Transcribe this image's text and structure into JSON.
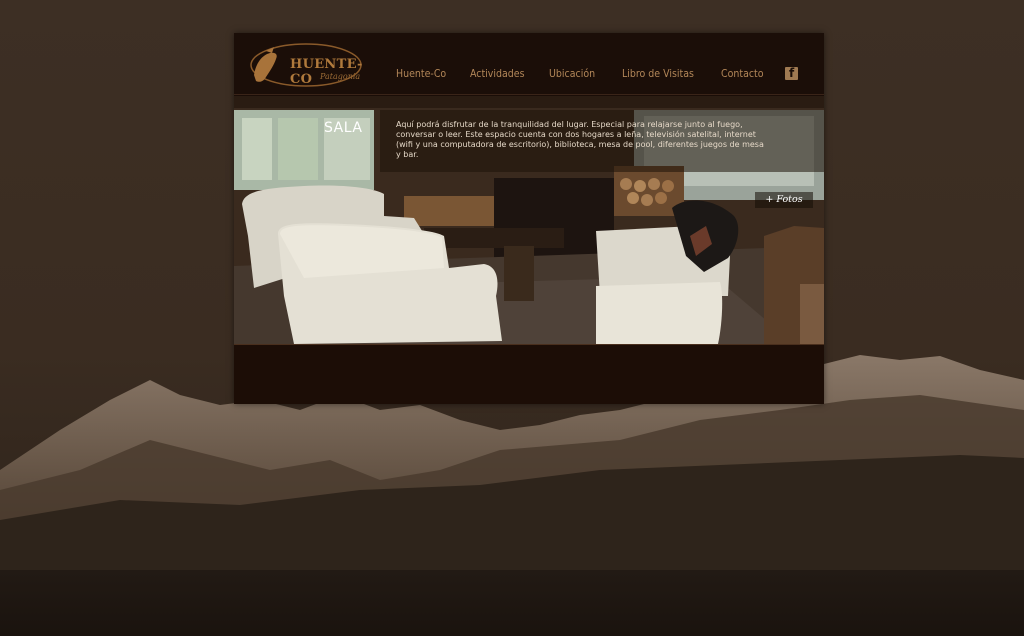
{
  "brand": {
    "name": "HUENTE-CO",
    "tagline": "Patagonia"
  },
  "nav": {
    "items": [
      {
        "label": "Huente-Co"
      },
      {
        "label": "Actividades"
      },
      {
        "label": "Ubicación"
      },
      {
        "label": "Libro de Visitas"
      },
      {
        "label": "Contacto"
      }
    ],
    "facebook_glyph": "f"
  },
  "gallery": {
    "title": "SALA",
    "text": "Aquí podrá disfrutar de la tranquilidad del lugar. Especial para relajarse junto al fuego, conversar o leer. Este espacio cuenta con dos hogares a leña, televisión satelital, internet (wifi y una computadora de escritorio), biblioteca, mesa de pool, diferentes juegos de mesa y bar.",
    "fotos_label": "+ Fotos"
  },
  "colors": {
    "panel": "#1a0d07",
    "nav_text": "#b28658",
    "logo": "#b07a3c",
    "background": "#3b2d22"
  }
}
